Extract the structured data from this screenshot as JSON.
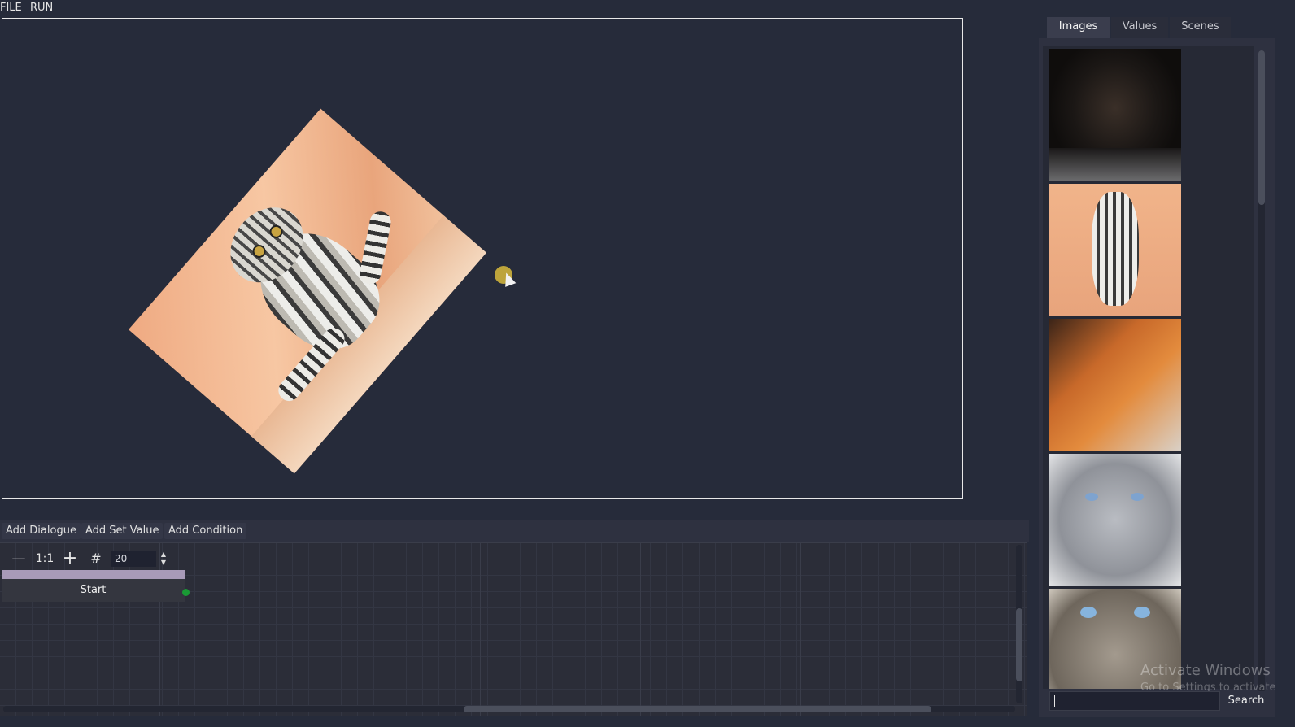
{
  "menu": {
    "file": "FILE",
    "run": "RUN"
  },
  "graph_toolbar": {
    "add_dialogue": "Add Dialogue",
    "add_set_value": "Add Set Value",
    "add_condition": "Add Condition"
  },
  "zoom": {
    "zoom_out_icon": "minus-icon",
    "reset_label": "1:1",
    "zoom_in_icon": "plus-icon",
    "snap_icon": "grid-snap-icon",
    "snap_value": "20"
  },
  "graph": {
    "start_node_label": "Start"
  },
  "tabs": [
    {
      "label": "Images",
      "active": true
    },
    {
      "label": "Values",
      "active": false
    },
    {
      "label": "Scenes",
      "active": false
    }
  ],
  "images": [
    {
      "name": "black-cat-thumbnail"
    },
    {
      "name": "tabby-cat-sitting-thumbnail"
    },
    {
      "name": "orange-cat-thumbnail"
    },
    {
      "name": "grey-cat-blue-eyes-thumbnail"
    },
    {
      "name": "tabby-cat-blue-eyes-thumbnail"
    }
  ],
  "search": {
    "value": "",
    "button_label": "Search"
  },
  "watermark": {
    "line1": "Activate Windows",
    "line2": "Go to Settings to activate"
  },
  "colors": {
    "background": "#262b3a",
    "panel": "#2e3140",
    "node_header": "#a89ab8",
    "port": "#1a9a35"
  }
}
